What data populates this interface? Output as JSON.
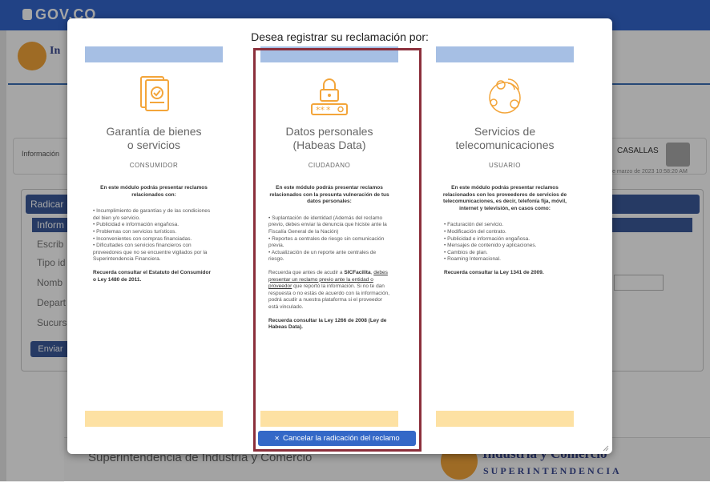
{
  "topbar": {
    "brand": "GOV.CO"
  },
  "background": {
    "logo_text": "In",
    "info_tab": "Información",
    "user_name": "CASALLAS",
    "date": "e marzo de 2023 10:58:20 AM",
    "form_header": "Radicar",
    "form_subheader": "Inform",
    "labels": [
      "Escrib",
      "Tipo id",
      "Nomb",
      "Depart",
      "Sucurs"
    ],
    "send_button": "Enviar",
    "footer_text": "Superintendencia de Industria y Comercio",
    "footer_logo_line1": "Industria y Comercio",
    "footer_logo_line2": "SUPERINTENDENCIA"
  },
  "modal": {
    "title": "Desea registrar su reclamación por:",
    "cancel_button": "Cancelar la radicación del reclamo",
    "options": [
      {
        "title_line1": "Garantía de bienes",
        "title_line2": "o servicios",
        "role": "CONSUMIDOR",
        "intro": "En este módulo podrás presentar reclamos relacionados con:",
        "items": [
          "• Incumplimiento de garantías y de las condiciones del bien y/o servicio.",
          "• Publicidad e información engañosa.",
          "• Problemas con servicios turísticos.",
          "• Inconvenientes con compras financiadas.",
          "• Dificultades con servicios financieros con proveedores que no se encuentre vigilados por la Superintendencia Financiera."
        ],
        "footer_note": "Recuerda consultar el Estatuto del Consumidor o Ley 1480 de 2011."
      },
      {
        "title_line1": "Datos personales",
        "title_line2": "(Habeas Data)",
        "role": "CIUDADANO",
        "intro": "En este módulo podrás presentar reclamos relacionados con la presunta vulneración de tus datos personales:",
        "items": [
          "• Suplantación de identidad (Además del reclamo previo, debes enviar la denuncia que hiciste ante la Fiscalía General de la Nación)",
          "• Reportes a centrales de riesgo sin comunicación previa.",
          "• Actualización de un reporte ante centrales de riesgo."
        ],
        "note_pre": "Recuerda que antes de acudir a",
        "note_brand": "SICFacilita",
        "note_comma": ",",
        "note_link": "debes presentar un reclamo previo ante la entidad o proveedor",
        "note_post": "que reportó la información. Si no te dan respuesta o no estás de acuerdo con la información, podrá acudir a nuestra plataforma si el proveedor está vinculado.",
        "footer_note": "Recuerda consultar la Ley 1266 de 2008 (Ley de Habeas Data)."
      },
      {
        "title_line1": "Servicios de",
        "title_line2": "telecomunicaciones",
        "role": "USUARIO",
        "intro": "En este módulo podrás presentar reclamos relacionados con los proveedores de servicios de telecomunicaciones, es decir, telefonía fija, móvil, internet y televisión, en casos como:",
        "items": [
          "• Facturación del servicio.",
          "• Modificación del contrato.",
          "• Publicidad e información engañosa.",
          "• Mensajes de contenido y aplicaciones.",
          "• Cambios de plan.",
          "• Roaming Internacional."
        ],
        "footer_note": "Recuerda consultar la Ley 1341 de 2009."
      }
    ]
  },
  "colors": {
    "accent": "#3468c7",
    "highlight_frame": "#8b2f3b",
    "icon_orange": "#f3a53a",
    "band_blue": "#a6bfe4",
    "band_yellow": "#fde1a3"
  }
}
